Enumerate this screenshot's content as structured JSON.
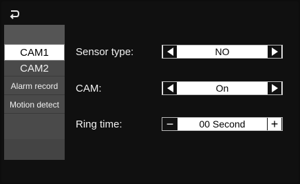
{
  "header": {
    "back_icon": "back-arrow-icon"
  },
  "sidebar": {
    "items": [
      {
        "label": "CAM1",
        "active": true
      },
      {
        "label": "CAM2",
        "active": false
      },
      {
        "label": "Alarm record",
        "active": false
      },
      {
        "label": "Motion detect",
        "active": false
      }
    ]
  },
  "settings": {
    "sensor_type": {
      "label": "Sensor type:",
      "value": "NO"
    },
    "cam": {
      "label": "CAM:",
      "value": "On"
    },
    "ring_time": {
      "label": "Ring time:",
      "value": "00 Second",
      "minus": "−",
      "plus": "+"
    }
  },
  "colors": {
    "background": "#101010",
    "sidebar": "#4a4a4a",
    "active_tab": "#ffffff",
    "control_bg": "#ffffff",
    "arrow_btn": "#111111"
  }
}
